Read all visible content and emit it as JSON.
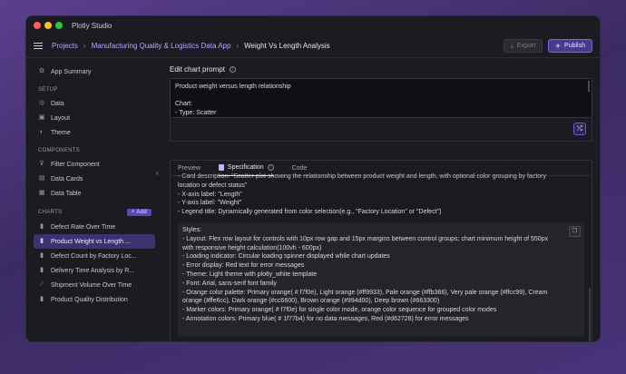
{
  "window": {
    "title": "Plotly Studio"
  },
  "topbar": {
    "breadcrumb": [
      "Projects",
      "Manufacturing Quality & Logistics Data App",
      "Weight Vs Length Analysis"
    ],
    "export_label": "Export",
    "publish_label": "Publish"
  },
  "sidebar": {
    "app_summary": "App Summary",
    "setup_label": "SETUP",
    "setup_items": [
      "Data",
      "Layout",
      "Theme"
    ],
    "components_label": "COMPONENTS",
    "component_items": [
      "Filter Component",
      "Data Cards",
      "Data Table"
    ],
    "charts_label": "CHARTS",
    "add_label": "+ Add",
    "chart_items": [
      "Defect Rate Over Time",
      "Product Weight vs Length ...",
      "Defect Count by Factory Loc...",
      "Delivery Time Analysis by R...",
      "Shipment Volume Over Time",
      "Product Quality Distribution"
    ],
    "active_chart_index": 1
  },
  "prompt": {
    "heading": "Edit chart prompt",
    "lines": [
      "Product weight versus length relationship",
      "",
      "Chart:",
      "- Type: Scatter"
    ]
  },
  "tabs": [
    "Preview",
    "Specification",
    "Code"
  ],
  "active_tab": "Specification",
  "spec": {
    "lines": [
      "- Card description: \"Scatter plot showing the relationship between product weight and length, with optional color grouping by factory",
      "location or defect status\"",
      "- X-axis label: \"Length\"",
      "- Y-axis label: \"Weight\"",
      "- Legend title: Dynamically generated from color selection(e.g., \"Factory Location\" or \"Defect\")"
    ],
    "styles_lines": [
      "Styles:",
      "- Layout: Flex row layout for controls with 10px row gap and 15px margins between control groups; chart minimum height of 550px",
      "with responsive height calculation(100vh - 600px)",
      "- Loading indicator: Circular loading spinner displayed while chart updates",
      "- Error display: Red text for error messages",
      "- Theme: Light theme with plotly_white template",
      "- Font: Arial, sans-serif font family",
      "- Orange color palette: Primary orange(  # f7f0e), Light orange (#ff9933), Pale orange (#ffb366), Very pale orange (#ffcc99), Cream",
      "orange (#ffe6cc), Dark orange (#cc6600), Brown orange (#994d00), Deep brown (#663300)",
      "- Marker colors: Primary orange(  # f7f0e) for single color mode, orange color sequence for grouped color modes",
      "- Annotation colors: Primary blue(  # 1f77b4) for no data messages, Red (#d62728) for error messages"
    ]
  }
}
